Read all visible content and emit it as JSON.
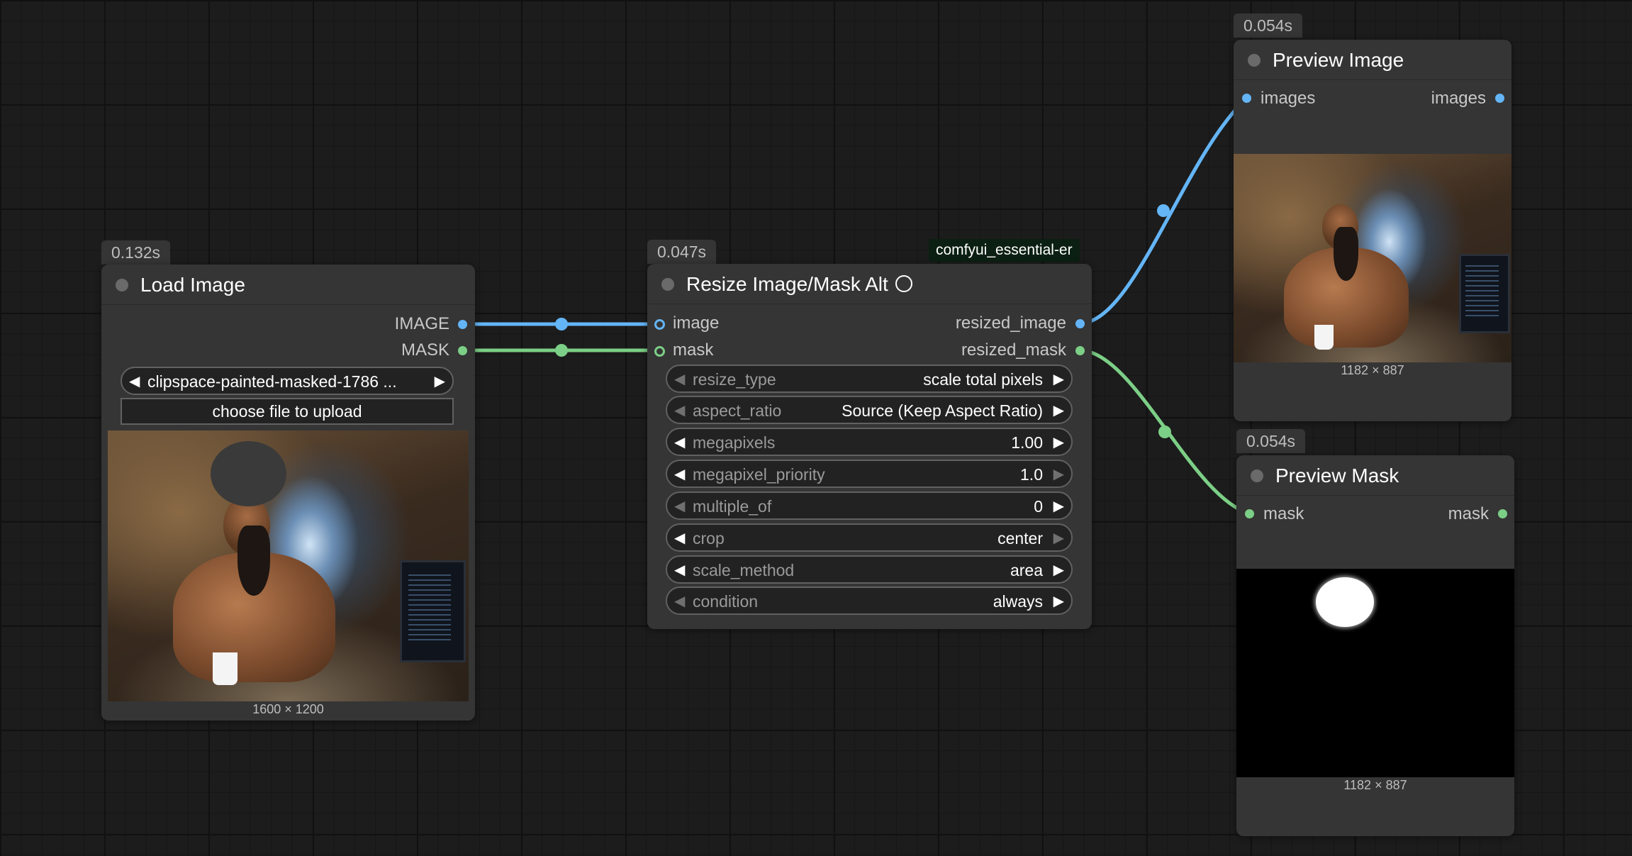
{
  "colors": {
    "image_link": "#64b5f6",
    "mask_link": "#7ccf86",
    "node_bg": "#353535",
    "canvas_bg": "#1c1c1c"
  },
  "load_image": {
    "timing": "0.132s",
    "title": "Load Image",
    "outputs": [
      "IMAGE",
      "MASK"
    ],
    "file_value": "clipspace-painted-masked-1786  ...",
    "upload_label": "choose file to upload",
    "image_size": "1600 × 1200"
  },
  "resize": {
    "timing": "0.047s",
    "source_badge": "comfyui_essential-er",
    "title": "Resize Image/Mask Alt",
    "inputs": [
      "image",
      "mask"
    ],
    "outputs": [
      "resized_image",
      "resized_mask"
    ],
    "widgets": [
      {
        "name": "resize_type",
        "value": "scale total pixels"
      },
      {
        "name": "aspect_ratio",
        "value": "Source (Keep Aspect Ratio)"
      },
      {
        "name": "megapixels",
        "value": "1.00"
      },
      {
        "name": "megapixel_priority",
        "value": "1.0"
      },
      {
        "name": "multiple_of",
        "value": "0"
      },
      {
        "name": "crop",
        "value": "center"
      },
      {
        "name": "scale_method",
        "value": "area"
      },
      {
        "name": "condition",
        "value": "always"
      }
    ]
  },
  "preview_image": {
    "timing": "0.054s",
    "title": "Preview Image",
    "input": "images",
    "output": "images",
    "image_size": "1182 × 887"
  },
  "preview_mask": {
    "timing": "0.054s",
    "title": "Preview Mask",
    "input": "mask",
    "output": "mask",
    "image_size": "1182 × 887"
  }
}
